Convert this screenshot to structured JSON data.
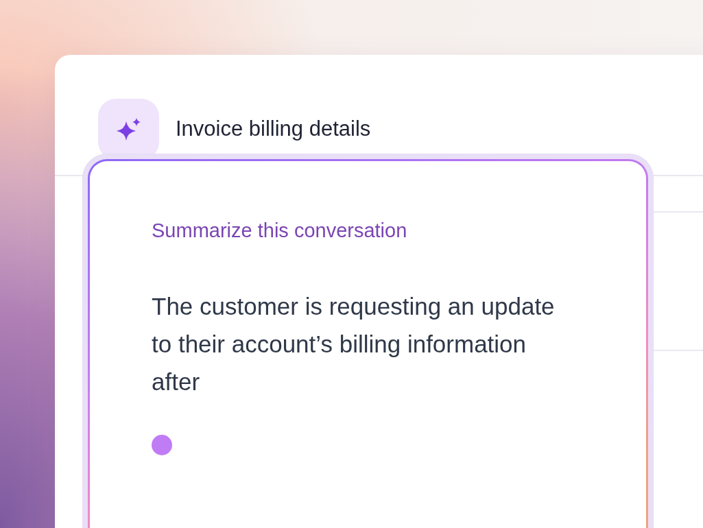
{
  "window": {
    "title": "Invoice billing details"
  },
  "assistant": {
    "prompt": "Summarize this conversation",
    "response": "The customer is requesting an update to their account’s billing information after",
    "typing": true
  }
}
